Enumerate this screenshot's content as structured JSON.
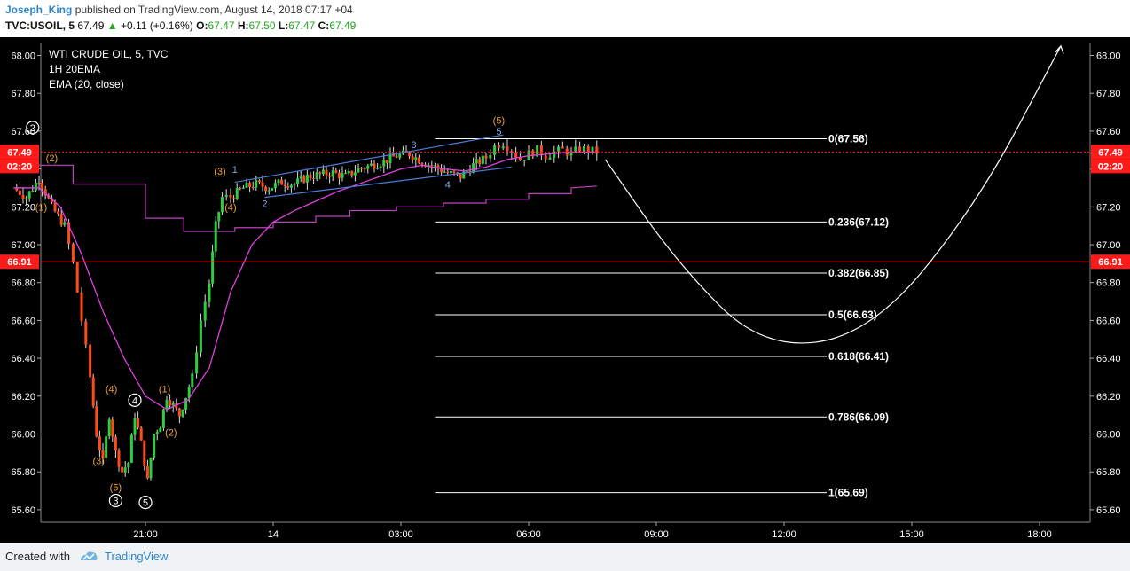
{
  "header": {
    "author": "Joseph_King",
    "published": "published on TradingView.com, August 14, 2018 07:17 +04",
    "symbol": "TVC:USOIL, 5",
    "last": "67.49",
    "change": "+0.11 (+0.16%)",
    "o_label": "O:",
    "o_value": "67.47",
    "h_label": "H:",
    "h_value": "67.50",
    "l_label": "L:",
    "l_value": "67.47",
    "c_label": "C:",
    "c_value": "67.49"
  },
  "legend": {
    "title": "WTI CRUDE OIL, 5, TVC",
    "line2": "1H 20EMA",
    "line3": "EMA (20, close)"
  },
  "footer": {
    "created": "Created with",
    "brand": "TradingView"
  },
  "colors": {
    "background": "#000000",
    "up": "#2ecc40",
    "down": "#ff4a1a",
    "ema": "#e040e0",
    "htf_ema": "#c040c0",
    "fib": "#ffffff",
    "hline": "#ff1a1a",
    "channel": "#4a7fd8",
    "count_minor": "#f0a030",
    "count_channel": "#7fa8e8",
    "count_major": "#ffffff"
  },
  "chart_data": {
    "type": "candlestick",
    "title": "WTI CRUDE OIL, 5, TVC",
    "ylim": [
      65.5,
      68.12
    ],
    "y_ticks": [
      "65.60",
      "65.80",
      "66.00",
      "66.20",
      "66.40",
      "66.60",
      "66.80",
      "67.00",
      "67.20",
      "67.40",
      "67.60",
      "67.80",
      "68.00"
    ],
    "x_ticks": [
      {
        "label": "21:00",
        "h": 21.0
      },
      {
        "label": "14",
        "h": 24.0
      },
      {
        "label": "03:00",
        "h": 27.0
      },
      {
        "label": "06:00",
        "h": 30.0
      },
      {
        "label": "09:00",
        "h": 33.0
      },
      {
        "label": "12:00",
        "h": 36.0
      },
      {
        "label": "15:00",
        "h": 39.0
      },
      {
        "label": "18:00",
        "h": 42.0
      }
    ],
    "price_path": [
      [
        17.9,
        67.3
      ],
      [
        18.2,
        67.25
      ],
      [
        18.5,
        67.35
      ],
      [
        18.8,
        67.2
      ],
      [
        19.1,
        67.1
      ],
      [
        19.3,
        66.9
      ],
      [
        19.5,
        66.6
      ],
      [
        19.7,
        66.3
      ],
      [
        19.85,
        66.0
      ],
      [
        20.0,
        65.85
      ],
      [
        20.15,
        66.1
      ],
      [
        20.3,
        65.9
      ],
      [
        20.45,
        65.8
      ],
      [
        20.6,
        65.85
      ],
      [
        20.75,
        66.1
      ],
      [
        20.9,
        65.95
      ],
      [
        21.05,
        65.75
      ],
      [
        21.2,
        66.0
      ],
      [
        21.35,
        66.05
      ],
      [
        21.5,
        66.2
      ],
      [
        21.65,
        66.15
      ],
      [
        21.8,
        66.1
      ],
      [
        21.95,
        66.2
      ],
      [
        22.1,
        66.3
      ],
      [
        22.3,
        66.6
      ],
      [
        22.5,
        66.8
      ],
      [
        22.65,
        67.1
      ],
      [
        22.8,
        67.25
      ],
      [
        23.0,
        67.25
      ],
      [
        23.3,
        67.3
      ],
      [
        23.6,
        67.32
      ],
      [
        23.9,
        67.3
      ],
      [
        24.2,
        67.33
      ],
      [
        24.5,
        67.32
      ],
      [
        24.8,
        67.36
      ],
      [
        25.1,
        67.37
      ],
      [
        25.4,
        67.38
      ],
      [
        25.7,
        67.36
      ],
      [
        26.0,
        67.4
      ],
      [
        26.3,
        67.42
      ],
      [
        26.6,
        67.44
      ],
      [
        26.9,
        67.47
      ],
      [
        27.2,
        67.48
      ],
      [
        27.5,
        67.44
      ],
      [
        27.8,
        67.41
      ],
      [
        28.1,
        67.38
      ],
      [
        28.4,
        67.36
      ],
      [
        28.7,
        67.42
      ],
      [
        29.0,
        67.46
      ],
      [
        29.2,
        67.52
      ],
      [
        29.4,
        67.54
      ],
      [
        29.6,
        67.5
      ],
      [
        29.8,
        67.45
      ],
      [
        30.0,
        67.48
      ],
      [
        30.2,
        67.5
      ],
      [
        30.4,
        67.47
      ],
      [
        30.6,
        67.49
      ],
      [
        30.8,
        67.5
      ],
      [
        31.0,
        67.48
      ],
      [
        31.2,
        67.51
      ],
      [
        31.4,
        67.5
      ],
      [
        31.6,
        67.49
      ]
    ],
    "ema": [
      [
        17.9,
        67.3
      ],
      [
        18.5,
        67.3
      ],
      [
        19.0,
        67.2
      ],
      [
        19.5,
        66.95
      ],
      [
        20.0,
        66.65
      ],
      [
        20.5,
        66.4
      ],
      [
        21.0,
        66.2
      ],
      [
        21.5,
        66.13
      ],
      [
        22.0,
        66.18
      ],
      [
        22.5,
        66.35
      ],
      [
        23.0,
        66.75
      ],
      [
        23.5,
        67.0
      ],
      [
        24.0,
        67.12
      ],
      [
        24.5,
        67.18
      ],
      [
        25.0,
        67.23
      ],
      [
        25.5,
        67.28
      ],
      [
        26.0,
        67.32
      ],
      [
        26.5,
        67.36
      ],
      [
        27.0,
        67.4
      ],
      [
        27.5,
        67.42
      ],
      [
        28.0,
        67.4
      ],
      [
        28.5,
        67.39
      ],
      [
        29.0,
        67.41
      ],
      [
        29.5,
        67.45
      ],
      [
        30.0,
        67.47
      ],
      [
        30.5,
        67.48
      ],
      [
        31.0,
        67.49
      ],
      [
        31.6,
        67.49
      ]
    ],
    "htf_ema_steps": [
      [
        17.9,
        67.42
      ],
      [
        19.3,
        67.42
      ],
      [
        19.3,
        67.32
      ],
      [
        21.0,
        67.32
      ],
      [
        21.0,
        67.14
      ],
      [
        21.9,
        67.14
      ],
      [
        21.9,
        67.07
      ],
      [
        23.1,
        67.07
      ],
      [
        23.1,
        67.09
      ],
      [
        24.0,
        67.09
      ],
      [
        24.0,
        67.12
      ],
      [
        25.0,
        67.12
      ],
      [
        25.0,
        67.15
      ],
      [
        25.8,
        67.15
      ],
      [
        25.8,
        67.18
      ],
      [
        26.9,
        67.18
      ],
      [
        26.9,
        67.2
      ],
      [
        28.0,
        67.2
      ],
      [
        28.0,
        67.22
      ],
      [
        29.0,
        67.22
      ],
      [
        29.0,
        67.24
      ],
      [
        30.0,
        67.24
      ],
      [
        30.0,
        67.27
      ],
      [
        31.0,
        67.27
      ],
      [
        31.0,
        67.3
      ],
      [
        31.6,
        67.31
      ]
    ],
    "fib_levels": [
      {
        "label": "0(67.56)",
        "value": 67.56
      },
      {
        "label": "0.236(67.12)",
        "value": 67.12
      },
      {
        "label": "0.382(66.85)",
        "value": 66.85
      },
      {
        "label": "0.5(66.63)",
        "value": 66.63
      },
      {
        "label": "0.618(66.41)",
        "value": 66.41
      },
      {
        "label": "0.786(66.09)",
        "value": 66.09
      },
      {
        "label": "1(65.69)",
        "value": 65.69
      }
    ],
    "fib_start_h": 27.8,
    "fib_end_h": 37.0,
    "horizontal_lines": [
      {
        "value": 67.49,
        "label": "67.49",
        "style": "dotted"
      },
      {
        "value": 66.91,
        "label": "66.91",
        "style": "solid"
      }
    ],
    "price_badge": {
      "value": 67.49,
      "label": "67.49",
      "sublabel": "02:20"
    },
    "channel": {
      "upper": [
        [
          23.1,
          67.33
        ],
        [
          29.4,
          67.58
        ]
      ],
      "lower": [
        [
          23.8,
          67.25
        ],
        [
          29.6,
          67.41
        ]
      ]
    },
    "projection": [
      [
        31.8,
        67.45
      ],
      [
        33.5,
        66.9
      ],
      [
        35.5,
        66.45
      ],
      [
        38.0,
        66.52
      ],
      [
        40.5,
        67.2
      ],
      [
        42.5,
        68.05
      ]
    ],
    "wave_labels": [
      {
        "text": "2",
        "h": 18.35,
        "v": 67.6,
        "style": "major"
      },
      {
        "text": "(2)",
        "h": 18.8,
        "v": 67.44,
        "style": "minor"
      },
      {
        "text": "(1)",
        "h": 18.55,
        "v": 67.18,
        "style": "minor"
      },
      {
        "text": "(4)",
        "h": 20.2,
        "v": 66.22,
        "style": "minor"
      },
      {
        "text": "4",
        "h": 20.75,
        "v": 66.16,
        "style": "major"
      },
      {
        "text": "(3)",
        "h": 19.9,
        "v": 65.84,
        "style": "minor"
      },
      {
        "text": "(5)",
        "h": 20.3,
        "v": 65.7,
        "style": "minor"
      },
      {
        "text": "3",
        "h": 20.3,
        "v": 65.63,
        "style": "major"
      },
      {
        "text": "5",
        "h": 21.0,
        "v": 65.62,
        "style": "major"
      },
      {
        "text": "(1)",
        "h": 21.45,
        "v": 66.22,
        "style": "minor"
      },
      {
        "text": "(2)",
        "h": 21.6,
        "v": 65.99,
        "style": "minor"
      },
      {
        "text": "(3)",
        "h": 22.75,
        "v": 67.37,
        "style": "minor"
      },
      {
        "text": "(4)",
        "h": 23.0,
        "v": 67.18,
        "style": "minor"
      },
      {
        "text": "1",
        "h": 23.1,
        "v": 67.38,
        "style": "channel"
      },
      {
        "text": "2",
        "h": 23.8,
        "v": 67.2,
        "style": "channel"
      },
      {
        "text": "3",
        "h": 27.3,
        "v": 67.51,
        "style": "channel"
      },
      {
        "text": "4",
        "h": 28.1,
        "v": 67.3,
        "style": "channel"
      },
      {
        "text": "(5)",
        "h": 29.3,
        "v": 67.64,
        "style": "minor"
      },
      {
        "text": "5",
        "h": 29.3,
        "v": 67.58,
        "style": "channel"
      }
    ]
  }
}
